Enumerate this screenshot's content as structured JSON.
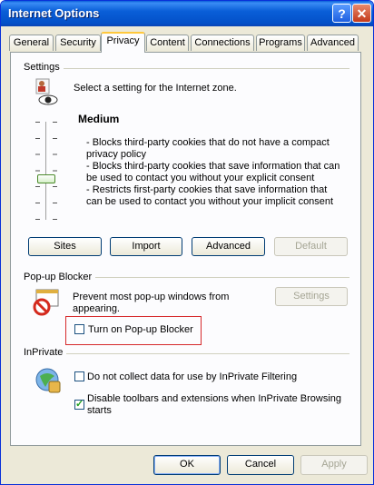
{
  "window": {
    "title": "Internet Options"
  },
  "tabs": [
    {
      "label": "General"
    },
    {
      "label": "Security"
    },
    {
      "label": "Privacy"
    },
    {
      "label": "Content"
    },
    {
      "label": "Connections"
    },
    {
      "label": "Programs"
    },
    {
      "label": "Advanced"
    }
  ],
  "active_tab": "Privacy",
  "settings": {
    "group_label": "Settings",
    "prompt": "Select a setting for the Internet zone.",
    "level_title": "Medium",
    "slider_level": "Medium",
    "description_lines": [
      "- Blocks third-party cookies that do not have a compact",
      "privacy policy",
      "- Blocks third-party cookies that save information that can",
      "be used to contact you without your explicit consent",
      "- Restricts first-party cookies that save information that",
      "can be used to contact you without your implicit consent"
    ],
    "buttons": {
      "sites": "Sites",
      "import": "Import",
      "advanced": "Advanced",
      "default": "Default"
    }
  },
  "popup": {
    "group_label": "Pop-up Blocker",
    "description_line1": "Prevent most pop-up windows from",
    "description_line2": "appearing.",
    "settings_button": "Settings",
    "checkbox_label": "Turn on Pop-up Blocker",
    "checkbox_checked": false,
    "highlight_color": "#d6292b"
  },
  "inprivate": {
    "group_label": "InPrivate",
    "checkbox1_label": "Do not collect data for use by InPrivate Filtering",
    "checkbox1_checked": false,
    "checkbox2_label_line1": "Disable toolbars and extensions when InPrivate Browsing",
    "checkbox2_label_line2": "starts",
    "checkbox2_checked": true
  },
  "footer": {
    "ok": "OK",
    "cancel": "Cancel",
    "apply": "Apply"
  },
  "colors": {
    "titlebar": "#0a5fd8",
    "face": "#ece9d8",
    "active_tab_accent": "#ffc83c"
  }
}
